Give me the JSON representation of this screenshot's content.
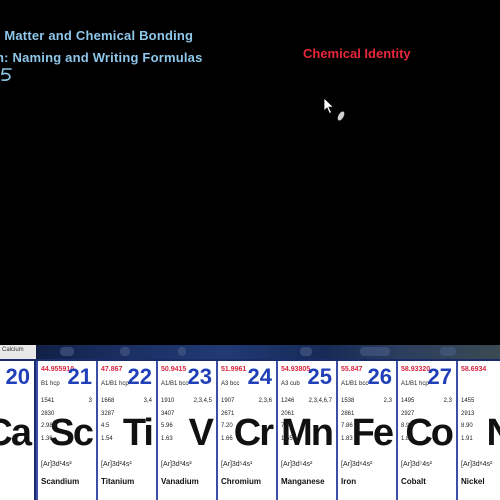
{
  "slide": {
    "line1": ": Matter and Chemical Bonding",
    "line2": "n:  Naming and Writing Formulas",
    "section_label": "Chemical Identity"
  },
  "colors": {
    "header": "#8ec7ea",
    "accent_red": "#e8273c",
    "atomic_number_blue": "#2140b8"
  },
  "strip": {
    "stub_text": "Calcium"
  },
  "elements": [
    {
      "number": "20",
      "mass": "",
      "struct": "",
      "ox": "",
      "props": [
        "",
        "",
        "",
        ""
      ],
      "symbol": "Ca",
      "config": "",
      "name": "um"
    },
    {
      "number": "21",
      "mass": "44.955910",
      "struct": "B1 hcp",
      "ox": "3",
      "props": [
        "1541",
        "2830",
        "2.989",
        "1.36"
      ],
      "symbol": "Sc",
      "config": "[Ar]3d¹4s²",
      "name": "Scandium"
    },
    {
      "number": "22",
      "mass": "47.867",
      "struct": "A1/B1 hcp",
      "ox": "3,4",
      "props": [
        "1668",
        "3287",
        "4.5",
        "1.54"
      ],
      "symbol": "Ti",
      "config": "[Ar]3d²4s²",
      "name": "Titanium"
    },
    {
      "number": "23",
      "mass": "50.9415",
      "struct": "A1/B1 bcc",
      "ox": "2,3,4,5",
      "props": [
        "1910",
        "3407",
        "5.96",
        "1.63"
      ],
      "symbol": "V",
      "config": "[Ar]3d³4s²",
      "name": "Vanadium"
    },
    {
      "number": "24",
      "mass": "51.9961",
      "struct": "A3 bcc",
      "ox": "2,3,6",
      "props": [
        "1907",
        "2671",
        "7.20",
        "1.66"
      ],
      "symbol": "Cr",
      "config": "[Ar]3d⁵4s¹",
      "name": "Chromium"
    },
    {
      "number": "25",
      "mass": "54.93805",
      "struct": "A3 cub",
      "ox": "2,3,4,6,7",
      "props": [
        "1246",
        "2061",
        "7.47",
        "1.55"
      ],
      "symbol": "Mn",
      "config": "[Ar]3d⁵4s²",
      "name": "Manganese"
    },
    {
      "number": "26",
      "mass": "55.847",
      "struct": "A1/B1 bcc",
      "ox": "2,3",
      "props": [
        "1538",
        "2861",
        "7.86",
        "1.83"
      ],
      "symbol": "Fe",
      "config": "[Ar]3d⁶4s²",
      "name": "Iron"
    },
    {
      "number": "27",
      "mass": "58.93320",
      "struct": "A1/B1 hcp",
      "ox": "2,3",
      "props": [
        "1495",
        "2927",
        "8.92",
        "1.88"
      ],
      "symbol": "Co",
      "config": "[Ar]3d⁷4s²",
      "name": "Cobalt"
    },
    {
      "number": "",
      "mass": "58.6934",
      "struct": "",
      "ox": "",
      "props": [
        "1455",
        "2913",
        "8.90",
        "1.91"
      ],
      "symbol": "N",
      "config": "[Ar]3d⁸4s²",
      "name": "Nickel"
    }
  ]
}
